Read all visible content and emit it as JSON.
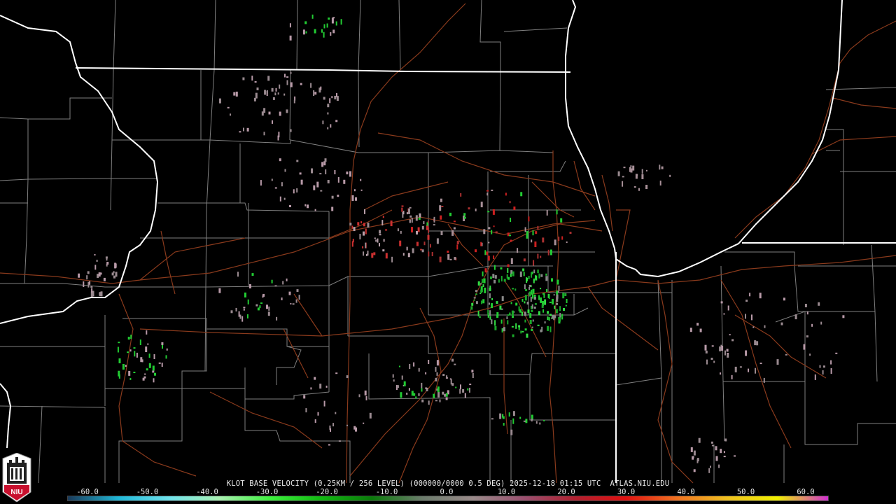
{
  "product": {
    "caption": "KLOT BASE VELOCITY (0.25KM / 256 LEVEL) (000000/0000 0.5 DEG) 2025-12-18 01:15 UTC  ATLAS.NIU.EDU"
  },
  "colorbar": {
    "tick_labels": [
      "-60.0",
      "-50.0",
      "-40.0",
      "-30.0",
      "-20.0",
      "-10.0",
      "0.0",
      "10.0",
      "20.0",
      "30.0",
      "40.0",
      "50.0",
      "60.0"
    ],
    "min": -60,
    "max": 60,
    "colors": [
      "#1a3a5a",
      "#1fb8d8",
      "#6fe2ec",
      "#a8f0b0",
      "#3cf03c",
      "#10b810",
      "#0a7a0a",
      "#6c7c6c",
      "#9a8a8a",
      "#9a5070",
      "#b02030",
      "#e01010",
      "#f07020",
      "#f0c020",
      "#f0f000",
      "#d030d0"
    ]
  },
  "logo": {
    "text": "NIU",
    "bg_color": "#c8102e"
  },
  "map": {
    "background": "#000000",
    "county_line_color": "#7f7f7f",
    "state_line_color": "#ffffff",
    "road_color": "#8a3a1c",
    "lake_shore_color": "#ffffff"
  }
}
